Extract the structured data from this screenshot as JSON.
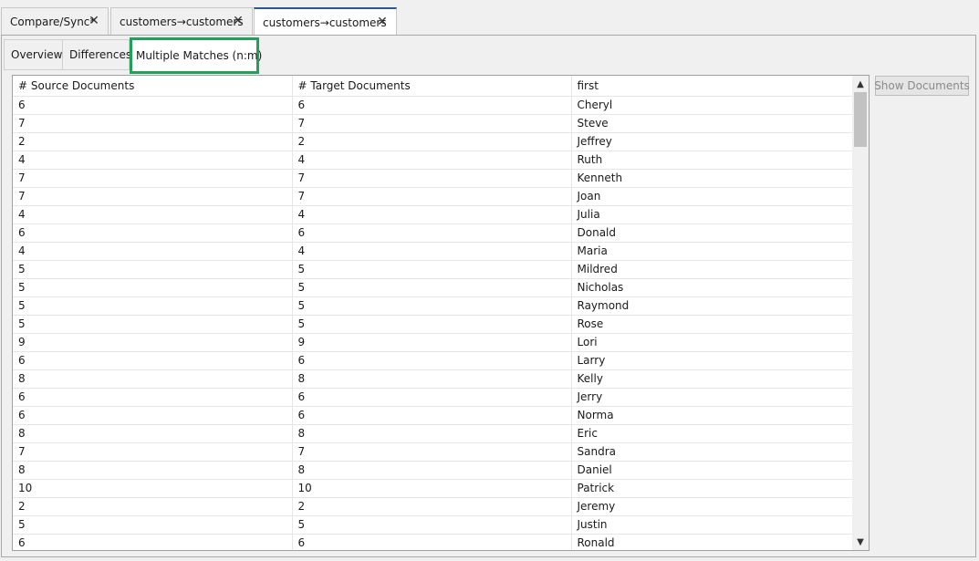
{
  "doc_tabs": [
    {
      "label": "Compare/Sync*"
    },
    {
      "label": "customers→customers"
    },
    {
      "label": "customers→customers"
    }
  ],
  "sub_tabs": [
    {
      "label": "Overview"
    },
    {
      "label": "Differences"
    },
    {
      "label": "Multiple Matches (n:m)"
    }
  ],
  "table": {
    "headers": [
      "# Source Documents",
      "# Target Documents",
      "first"
    ],
    "rows": [
      [
        "6",
        "6",
        "Cheryl"
      ],
      [
        "7",
        "7",
        "Steve"
      ],
      [
        "2",
        "2",
        "Jeffrey"
      ],
      [
        "4",
        "4",
        "Ruth"
      ],
      [
        "7",
        "7",
        "Kenneth"
      ],
      [
        "7",
        "7",
        "Joan"
      ],
      [
        "4",
        "4",
        "Julia"
      ],
      [
        "6",
        "6",
        "Donald"
      ],
      [
        "4",
        "4",
        "Maria"
      ],
      [
        "5",
        "5",
        "Mildred"
      ],
      [
        "5",
        "5",
        "Nicholas"
      ],
      [
        "5",
        "5",
        "Raymond"
      ],
      [
        "5",
        "5",
        "Rose"
      ],
      [
        "9",
        "9",
        "Lori"
      ],
      [
        "6",
        "6",
        "Larry"
      ],
      [
        "8",
        "8",
        "Kelly"
      ],
      [
        "6",
        "6",
        "Jerry"
      ],
      [
        "6",
        "6",
        "Norma"
      ],
      [
        "8",
        "8",
        "Eric"
      ],
      [
        "7",
        "7",
        "Sandra"
      ],
      [
        "8",
        "8",
        "Daniel"
      ],
      [
        "10",
        "10",
        "Patrick"
      ],
      [
        "2",
        "2",
        "Jeremy"
      ],
      [
        "5",
        "5",
        "Justin"
      ],
      [
        "6",
        "6",
        "Ronald"
      ]
    ]
  },
  "show_documents_label": "Show Documents",
  "icons": {
    "close": "close-icon",
    "scroll_up": "chevron-up-icon",
    "scroll_down": "chevron-down-icon"
  }
}
